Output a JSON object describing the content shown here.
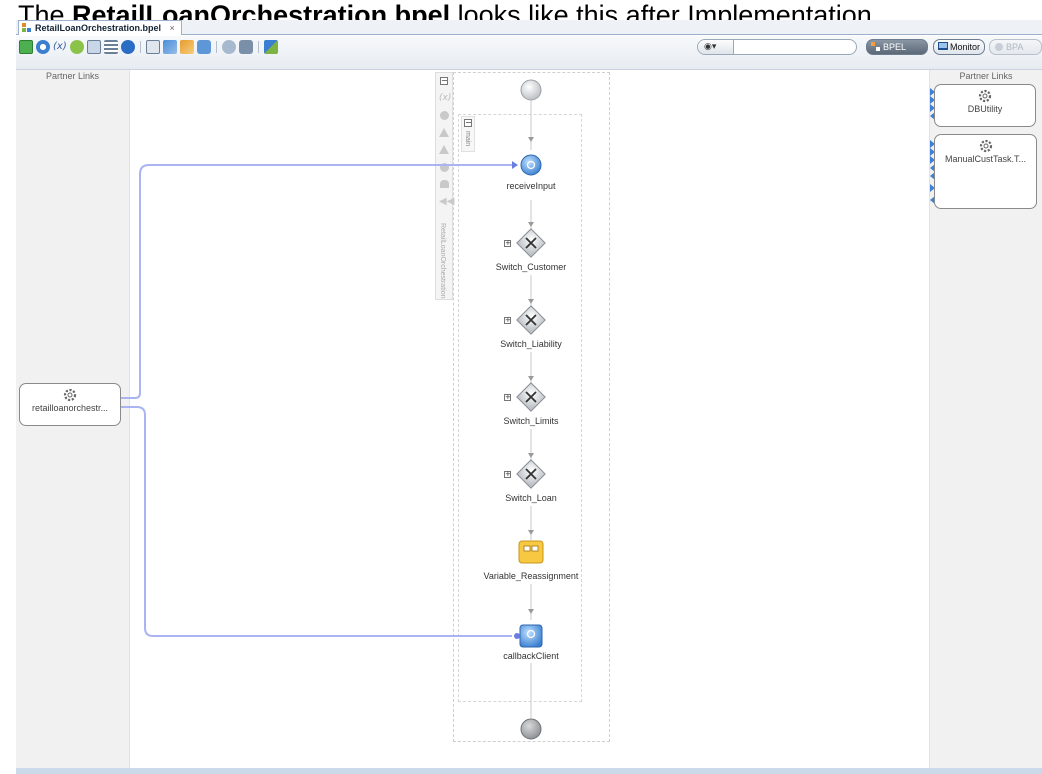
{
  "caption": {
    "prefix": "The ",
    "bold": "RetailLoanOrchestration.bpel",
    "suffix": " looks like this after Implementation"
  },
  "tab": {
    "title": "RetailLoanOrchestration.bpel",
    "close": "×"
  },
  "search": {
    "placeholder": ""
  },
  "buttons": {
    "bpel": "BPEL",
    "monitor": "Monitor",
    "bpa": "BPA"
  },
  "left_panel": {
    "label": "Partner Links",
    "partner_link": "retailloanorchestr..."
  },
  "right_panel": {
    "label": "Partner Links",
    "partner_links": [
      {
        "name": "DBUtility"
      },
      {
        "name": "ManualCustTask.T..."
      }
    ]
  },
  "process": {
    "scope_name": "RetailLoanOrchestration",
    "main_label": "main",
    "activities": [
      {
        "name": "receiveInput"
      },
      {
        "name": "Switch_Customer"
      },
      {
        "name": "Switch_Liability"
      },
      {
        "name": "Switch_Limits"
      },
      {
        "name": "Switch_Loan"
      },
      {
        "name": "Variable_Reassignment"
      },
      {
        "name": "callbackClient"
      }
    ]
  },
  "colors": {
    "accent": "#3a7fd0",
    "link": "#aab4f2",
    "assign": "#f7c842"
  }
}
